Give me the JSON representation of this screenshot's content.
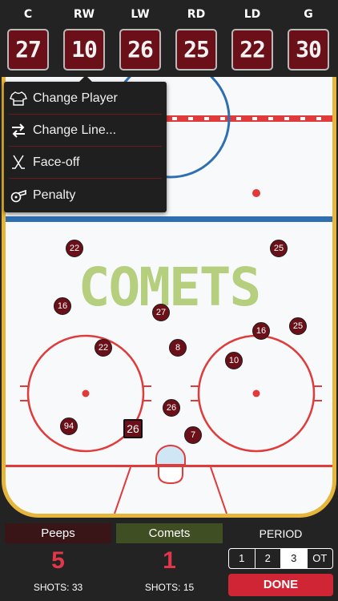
{
  "line": [
    {
      "pos": "C",
      "number": "27"
    },
    {
      "pos": "RW",
      "number": "10"
    },
    {
      "pos": "LW",
      "number": "26"
    },
    {
      "pos": "RD",
      "number": "25"
    },
    {
      "pos": "LD",
      "number": "22"
    },
    {
      "pos": "G",
      "number": "30"
    }
  ],
  "menu": {
    "items": [
      {
        "label": "Change Player",
        "icon": "jersey-icon"
      },
      {
        "label": "Change Line...",
        "icon": "swap-arrows-icon"
      },
      {
        "label": "Face-off",
        "icon": "crossed-sticks-icon"
      },
      {
        "label": "Penalty",
        "icon": "whistle-icon"
      }
    ]
  },
  "rink": {
    "team_logo": "COMETS",
    "players": [
      {
        "number": "22"
      },
      {
        "number": "25"
      },
      {
        "number": "16"
      },
      {
        "number": "27"
      },
      {
        "number": "16"
      },
      {
        "number": "25"
      },
      {
        "number": "22"
      },
      {
        "number": "8"
      },
      {
        "number": "10"
      },
      {
        "number": "26"
      },
      {
        "number": "94"
      },
      {
        "number": "26"
      },
      {
        "number": "7"
      }
    ]
  },
  "score": {
    "home": {
      "name": "Peeps",
      "goals": "5",
      "shots": "SHOTS: 33",
      "color": "#3a1517"
    },
    "away": {
      "name": "Comets",
      "goals": "1",
      "shots": "SHOTS: 15",
      "color": "#3f4f23"
    }
  },
  "period": {
    "label": "PERIOD",
    "options": [
      "1",
      "2",
      "3",
      "OT"
    ],
    "selected": "3",
    "done_label": "DONE"
  },
  "colors": {
    "accent_red": "#cf2535",
    "jersey": "#6b1018",
    "rink_border": "#e6b63c",
    "line_blue": "#2f6fb0"
  }
}
